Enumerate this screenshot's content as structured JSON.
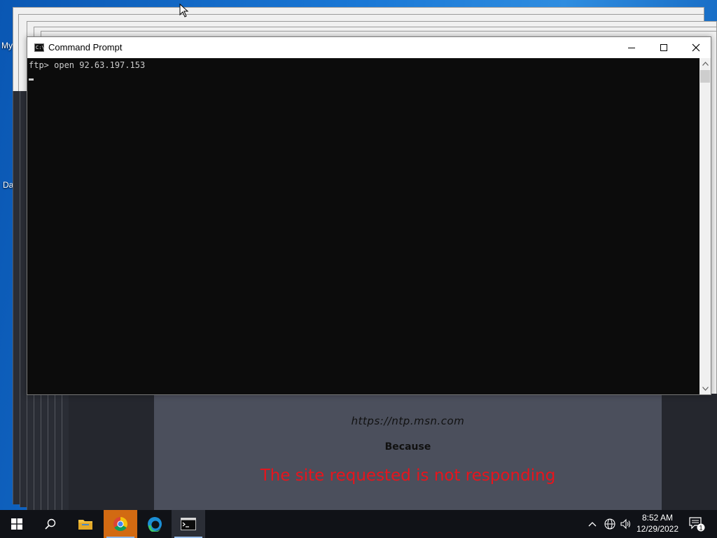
{
  "desktop": {
    "icons": [
      {
        "label": "My"
      },
      {
        "label": "Da"
      }
    ]
  },
  "browser_error": {
    "url": "https://ntp.msn.com",
    "because": "Because",
    "message": "The site requested is not responding"
  },
  "cmd_window": {
    "title": "Command Prompt",
    "icon": "cmd-icon",
    "buttons": {
      "minimize": "minimize-icon",
      "maximize": "maximize-icon",
      "close": "close-icon"
    },
    "console_lines": [
      "ftp> open 92.63.197.153"
    ]
  },
  "taskbar": {
    "apps": [
      {
        "name": "start",
        "icon": "windows-logo-icon"
      },
      {
        "name": "search",
        "icon": "search-icon"
      },
      {
        "name": "file-explorer",
        "icon": "folder-icon"
      },
      {
        "name": "chrome",
        "icon": "chrome-icon"
      },
      {
        "name": "edge",
        "icon": "edge-icon"
      },
      {
        "name": "command-prompt",
        "icon": "cmd-icon"
      }
    ],
    "clock_time": "8:52 AM",
    "clock_date": "12/29/2022",
    "notification_count": "1"
  },
  "colors": {
    "error_text": "#e8141c",
    "console_bg": "#0c0c0c",
    "taskbar_bg": "#101217",
    "chrome_active": "#d26a12"
  }
}
